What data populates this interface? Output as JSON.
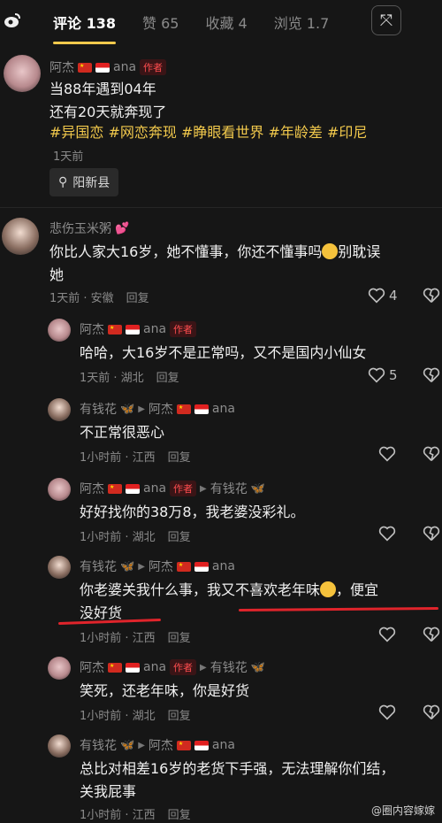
{
  "tabs": {
    "comments": "评论 138",
    "likes": "赞 65",
    "favorites": "收藏 4",
    "views": "浏览 1.7"
  },
  "expand_icon": "expand-icon",
  "post": {
    "author": "阿杰",
    "author_suffix": "ana",
    "badge": "作者",
    "line1": "当88年遇到04年",
    "line2": "还有20天就奔现了",
    "hashtags": "#异国恋 #网恋奔现 #睁眼看世界 #年龄差 #印尼",
    "time": "1天前",
    "location": "阳新县"
  },
  "comments": [
    {
      "user": "悲伤玉米粥",
      "text1": "你比人家大16岁，她不懂事，你还不懂事吗",
      "text1b": "别耽误",
      "text2": "她",
      "time": "1天前 · 安徽",
      "reply": "回复",
      "likes": "4"
    },
    {
      "user": "阿杰",
      "suffix": "ana",
      "badge": "作者",
      "text": "哈哈，大16岁不是正常吗，又不是国内小仙女",
      "time": "1天前 · 湖北",
      "reply": "回复",
      "likes": "5"
    },
    {
      "user": "有钱花",
      "to": "阿杰",
      "to_suffix": "ana",
      "text": "不正常很恶心",
      "time": "1小时前 · 江西",
      "reply": "回复"
    },
    {
      "user": "阿杰",
      "suffix": "ana",
      "badge": "作者",
      "to": "有钱花",
      "text": "好好找你的38万8，我老婆没彩礼。",
      "time": "1小时前 · 湖北",
      "reply": "回复"
    },
    {
      "user": "有钱花",
      "to": "阿杰",
      "to_suffix": "ana",
      "text1": "你老婆关我什么事，我又不喜欢老年味",
      "text1b": "，便宜",
      "text2": "没好货",
      "time": "1小时前 · 江西",
      "reply": "回复"
    },
    {
      "user": "阿杰",
      "suffix": "ana",
      "badge": "作者",
      "to": "有钱花",
      "text": "笑死，还老年味，你是好货",
      "time": "1小时前 · 湖北",
      "reply": "回复"
    },
    {
      "user": "有钱花",
      "to": "阿杰",
      "to_suffix": "ana",
      "text1": "总比对相差16岁的老货下手强，无法理解你们结，",
      "text2": "关我屁事",
      "time": "1小时前 · 江西",
      "reply": "回复"
    }
  ],
  "watermark": "@圈内容嫁嫁",
  "colors": {
    "accent": "#f2c94c",
    "author_badge": "#ff4d4f",
    "annotation": "#e0242b",
    "background": "#161616"
  }
}
